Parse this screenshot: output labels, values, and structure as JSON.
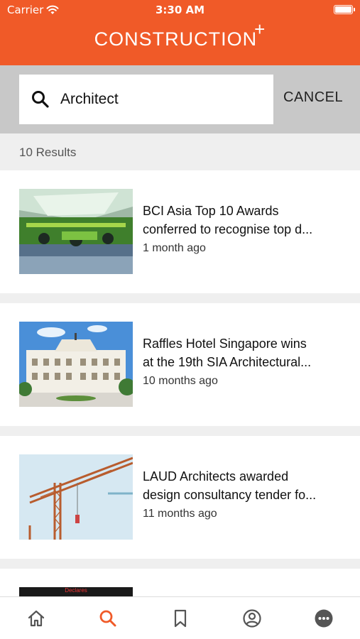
{
  "status": {
    "carrier": "Carrier",
    "time": "3:30 AM"
  },
  "header": {
    "logo": "CONSTRUCTION",
    "logo_mark": "+"
  },
  "search": {
    "value": "Architect",
    "cancel_label": "CANCEL"
  },
  "results": {
    "count_label": "10 Results"
  },
  "articles": [
    {
      "title_line1": "BCI Asia Top 10 Awards",
      "title_line2": "conferred to recognise top d...",
      "time": "1 month ago"
    },
    {
      "title_line1": "Raffles Hotel Singapore wins",
      "title_line2": "at the 19th SIA Architectural...",
      "time": "10 months ago"
    },
    {
      "title_line1": "LAUD Architects awarded",
      "title_line2": "design consultancy tender fo...",
      "time": "11 months ago"
    }
  ],
  "partial_thumb_text": "Declares",
  "tabbar": {
    "items": [
      "home-icon",
      "search-icon",
      "bookmark-icon",
      "profile-icon",
      "more-icon"
    ],
    "active": "search-icon"
  },
  "colors": {
    "brand": "#f05a28",
    "search_bg": "#c8c8c8",
    "active_tab": "#f05a28",
    "inactive_tab": "#555555"
  }
}
